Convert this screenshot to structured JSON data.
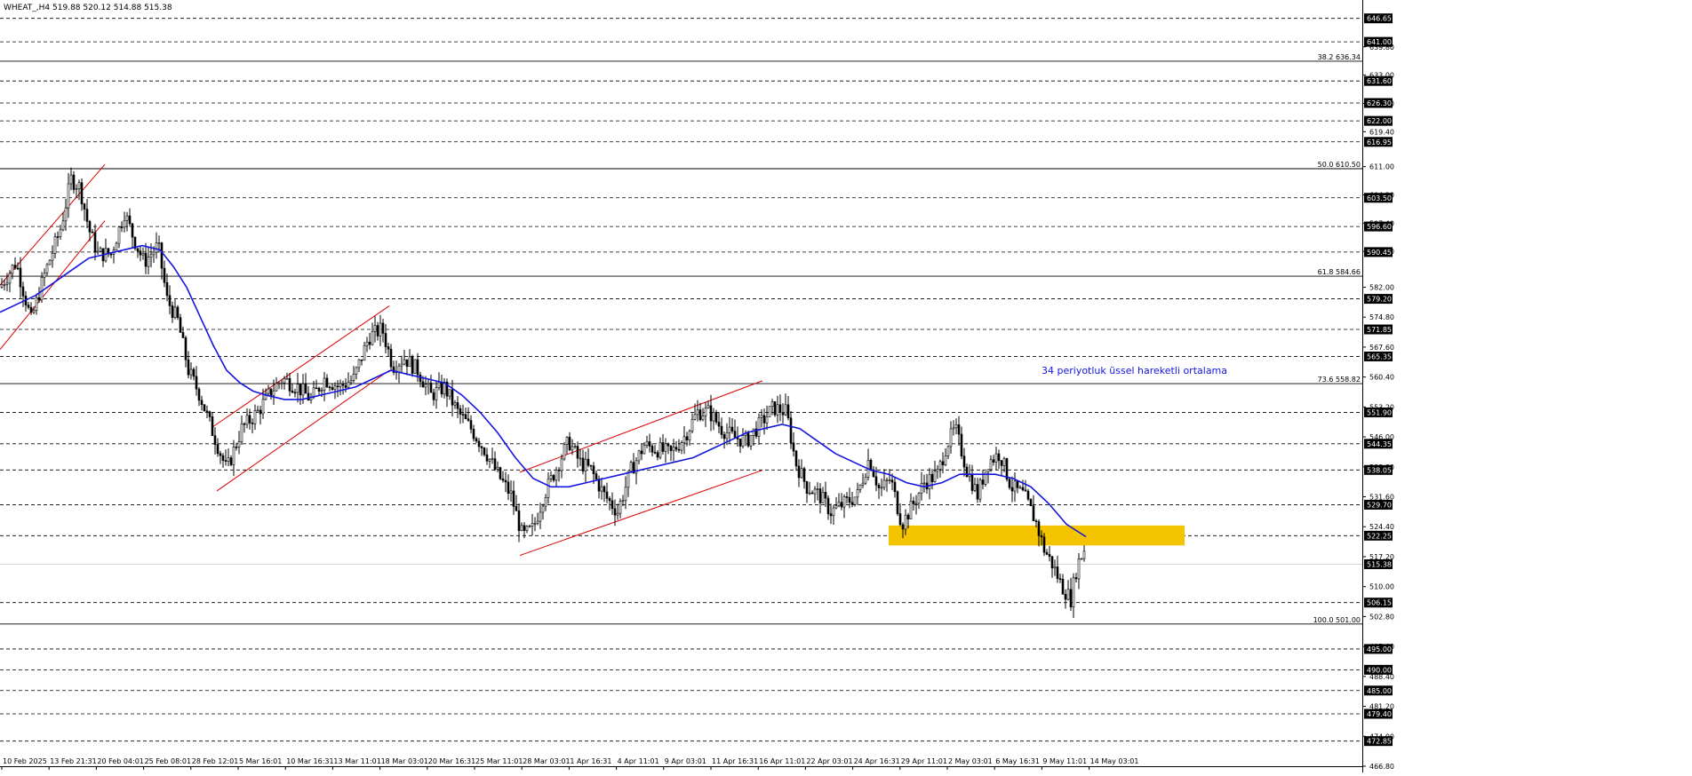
{
  "chart_data": {
    "type": "candlestick",
    "header": "WHEAT_,H4  519.88 520.12 514.88 515.38",
    "current_price": 515.38,
    "ylim": [
      466.8,
      650.0
    ],
    "grid": "horizontal dashed",
    "colors": {
      "background": "#ffffff",
      "candle": "#000000",
      "ema": "#1515e0",
      "channel": "#dd0000",
      "zone": "#f5c400",
      "ema_label": "#1515e0",
      "price_box": "#000000"
    },
    "y_ticks": [
      "639.80",
      "633.00",
      "626.20",
      "619.40",
      "611.00",
      "604.20",
      "597.40",
      "590.60",
      "582.00",
      "574.80",
      "567.60",
      "560.40",
      "553.20",
      "546.00",
      "538.80",
      "531.60",
      "524.40",
      "517.20",
      "510.00",
      "502.80",
      "495.60",
      "488.40",
      "481.20",
      "474.00",
      "466.80"
    ],
    "level_tags": [
      "646.65",
      "641.00",
      "631.60",
      "626.30",
      "622.00",
      "616.95",
      "603.50",
      "596.60",
      "590.45",
      "579.20",
      "571.85",
      "565.35",
      "551.90",
      "544.35",
      "538.05",
      "529.70",
      "522.25",
      "506.15",
      "495.00",
      "490.00",
      "485.00",
      "479.40",
      "472.85"
    ],
    "fibonacci": [
      {
        "label": "38.2 636.34",
        "value": 636.34
      },
      {
        "label": "50.0 610.50",
        "value": 610.5
      },
      {
        "label": "61.8 584.66",
        "value": 584.66
      },
      {
        "label": "73.6 558.82",
        "value": 558.82
      },
      {
        "label": "100.0 501.00",
        "value": 501.0
      }
    ],
    "x_labels": [
      "10 Feb 2025",
      "13 Feb 21:31",
      "20 Feb 04:01",
      "25 Feb 08:01",
      "28 Feb 12:01",
      "5 Mar 16:01",
      "10 Mar 16:31",
      "13 Mar 11:01",
      "18 Mar 03:01",
      "20 Mar 16:31",
      "25 Mar 11:01",
      "28 Mar 03:01",
      "1 Apr 16:31",
      "4 Apr 11:01",
      "9 Apr 03:01",
      "11 Apr 16:31",
      "16 Apr 11:01",
      "22 Apr 03:01",
      "24 Apr 16:31",
      "29 Apr 11:01",
      "2 May 03:01",
      "6 May 16:31",
      "9 May 11:01",
      "14 May 03:01"
    ],
    "price_path": [
      [
        0,
        582
      ],
      [
        18,
        588
      ],
      [
        35,
        574
      ],
      [
        50,
        585
      ],
      [
        68,
        596
      ],
      [
        80,
        608
      ],
      [
        90,
        606
      ],
      [
        100,
        596
      ],
      [
        110,
        590
      ],
      [
        125,
        590
      ],
      [
        140,
        600
      ],
      [
        150,
        594
      ],
      [
        162,
        588
      ],
      [
        178,
        592
      ],
      [
        188,
        579
      ],
      [
        200,
        574
      ],
      [
        212,
        562
      ],
      [
        225,
        556
      ],
      [
        238,
        548
      ],
      [
        255,
        538
      ],
      [
        272,
        548
      ],
      [
        290,
        552
      ],
      [
        305,
        557
      ],
      [
        318,
        560
      ],
      [
        335,
        558
      ],
      [
        350,
        555
      ],
      [
        365,
        560
      ],
      [
        382,
        558
      ],
      [
        398,
        560
      ],
      [
        415,
        570
      ],
      [
        430,
        572
      ],
      [
        442,
        563
      ],
      [
        455,
        565
      ],
      [
        470,
        562
      ],
      [
        485,
        556
      ],
      [
        500,
        558
      ],
      [
        515,
        552
      ],
      [
        530,
        548
      ],
      [
        545,
        543
      ],
      [
        560,
        537
      ],
      [
        575,
        532
      ],
      [
        588,
        522
      ],
      [
        600,
        524
      ],
      [
        612,
        532
      ],
      [
        625,
        538
      ],
      [
        640,
        545
      ],
      [
        652,
        540
      ],
      [
        665,
        538
      ],
      [
        680,
        532
      ],
      [
        695,
        528
      ],
      [
        710,
        538
      ],
      [
        725,
        544
      ],
      [
        740,
        543
      ],
      [
        755,
        542
      ],
      [
        770,
        546
      ],
      [
        785,
        552
      ],
      [
        798,
        552
      ],
      [
        812,
        548
      ],
      [
        825,
        546
      ],
      [
        840,
        545
      ],
      [
        855,
        549
      ],
      [
        870,
        553
      ],
      [
        885,
        552
      ],
      [
        895,
        540
      ],
      [
        908,
        534
      ],
      [
        922,
        532
      ],
      [
        935,
        528
      ],
      [
        950,
        530
      ],
      [
        965,
        532
      ],
      [
        978,
        541
      ],
      [
        990,
        533
      ],
      [
        1002,
        536
      ],
      [
        1015,
        525
      ],
      [
        1028,
        530
      ],
      [
        1040,
        535
      ],
      [
        1055,
        537
      ],
      [
        1065,
        544
      ],
      [
        1075,
        548
      ],
      [
        1088,
        538
      ],
      [
        1100,
        532
      ],
      [
        1112,
        540
      ],
      [
        1125,
        542
      ],
      [
        1138,
        534
      ],
      [
        1152,
        532
      ],
      [
        1165,
        526
      ],
      [
        1175,
        519
      ],
      [
        1185,
        515
      ],
      [
        1195,
        510
      ],
      [
        1205,
        507
      ],
      [
        1212,
        515
      ],
      [
        1220,
        519
      ]
    ],
    "ema_path": [
      [
        0,
        576
      ],
      [
        20,
        578
      ],
      [
        40,
        580
      ],
      [
        60,
        583
      ],
      [
        80,
        586
      ],
      [
        100,
        589
      ],
      [
        120,
        590
      ],
      [
        140,
        591
      ],
      [
        160,
        592
      ],
      [
        180,
        591
      ],
      [
        195,
        587
      ],
      [
        210,
        582
      ],
      [
        225,
        575
      ],
      [
        240,
        568
      ],
      [
        255,
        562
      ],
      [
        270,
        559
      ],
      [
        285,
        557
      ],
      [
        300,
        556
      ],
      [
        320,
        555
      ],
      [
        340,
        555
      ],
      [
        360,
        556
      ],
      [
        380,
        557
      ],
      [
        400,
        558
      ],
      [
        420,
        560
      ],
      [
        440,
        562
      ],
      [
        460,
        561
      ],
      [
        480,
        560
      ],
      [
        500,
        559
      ],
      [
        520,
        556
      ],
      [
        540,
        552
      ],
      [
        560,
        547
      ],
      [
        580,
        541
      ],
      [
        600,
        536
      ],
      [
        620,
        534
      ],
      [
        640,
        534
      ],
      [
        660,
        535
      ],
      [
        680,
        536
      ],
      [
        700,
        537
      ],
      [
        720,
        538
      ],
      [
        740,
        539
      ],
      [
        760,
        540
      ],
      [
        780,
        541
      ],
      [
        800,
        543
      ],
      [
        820,
        545
      ],
      [
        840,
        547
      ],
      [
        860,
        548
      ],
      [
        880,
        549
      ],
      [
        900,
        548
      ],
      [
        920,
        545
      ],
      [
        940,
        542
      ],
      [
        960,
        540
      ],
      [
        980,
        538
      ],
      [
        1000,
        537
      ],
      [
        1020,
        535
      ],
      [
        1040,
        534
      ],
      [
        1060,
        535
      ],
      [
        1080,
        537
      ],
      [
        1100,
        537
      ],
      [
        1120,
        537
      ],
      [
        1140,
        536
      ],
      [
        1160,
        534
      ],
      [
        1180,
        530
      ],
      [
        1200,
        525
      ],
      [
        1222,
        522
      ]
    ],
    "channels": [
      {
        "from": [
          0,
          582.5
        ],
        "to": [
          118,
          611.5
        ]
      },
      {
        "from": [
          0,
          567
        ],
        "to": [
          118,
          598
        ]
      },
      {
        "from": [
          240,
          548.5
        ],
        "to": [
          438,
          577.5
        ]
      },
      {
        "from": [
          244,
          533
        ],
        "to": [
          438,
          562
        ]
      },
      {
        "from": [
          585,
          537.5
        ],
        "to": [
          858,
          559.5
        ]
      },
      {
        "from": [
          585,
          517.5
        ],
        "to": [
          858,
          538
        ]
      }
    ],
    "support_zone": {
      "x_start": 1000,
      "x_end": 1333,
      "high": 524.7,
      "low": 519.9
    },
    "ema_label": "34 periyotluk üssel hareketli ortalama"
  }
}
